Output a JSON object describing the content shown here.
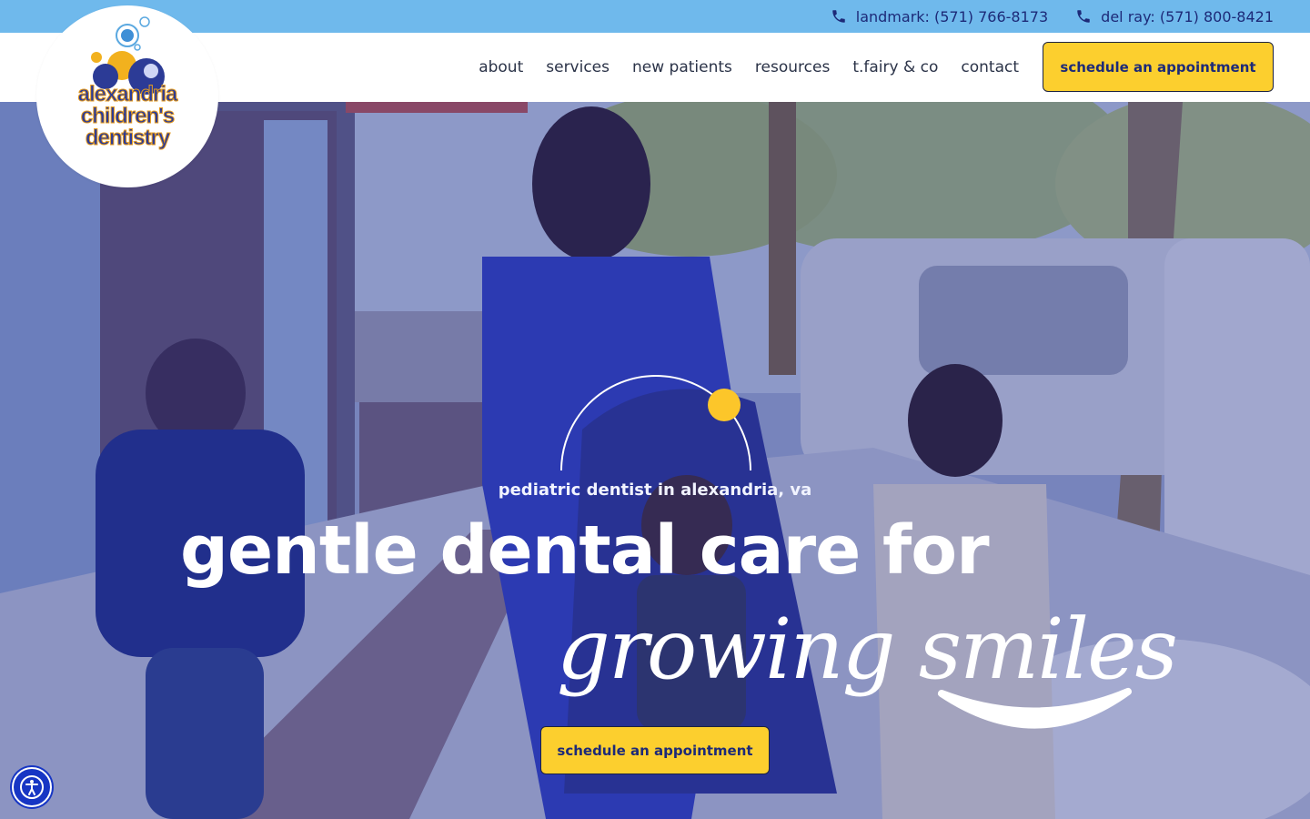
{
  "topbar": {
    "phones": [
      {
        "label": "landmark: (571) 766-8173",
        "icon": "phone-icon"
      },
      {
        "label": "del ray: (571) 800-8421",
        "icon": "phone-icon"
      }
    ]
  },
  "logo": {
    "line1": "alexandria",
    "line2": "children's",
    "line3": "dentistry"
  },
  "nav": {
    "items": [
      "about",
      "services",
      "new patients",
      "resources",
      "t.fairy & co",
      "contact"
    ],
    "cta": "schedule an appointment"
  },
  "hero": {
    "eyebrow": "pediatric dentist in alexandria, va",
    "headline": "gentle dental care for",
    "script": "growing smiles",
    "cta": "schedule an appointment"
  },
  "colors": {
    "topbar": "#6fb9ec",
    "accent_yellow": "#fccf2e",
    "navy": "#1d2a78",
    "accessibility": "#1736c4"
  },
  "accessibility": {
    "icon": "accessibility-icon"
  }
}
